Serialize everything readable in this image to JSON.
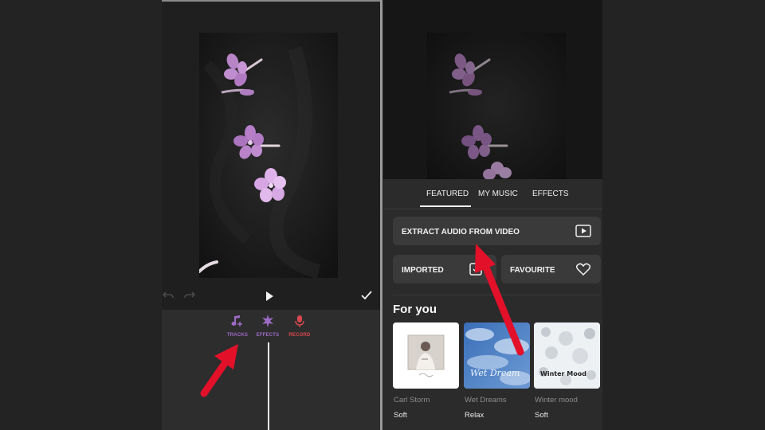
{
  "left": {
    "tools": [
      {
        "label": "TRACKS",
        "color": "#9d6bc6",
        "icon": "music-note-plus-icon"
      },
      {
        "label": "EFFECTS",
        "color": "#9d6bc6",
        "icon": "sparkle-icon"
      },
      {
        "label": "RECORD",
        "color": "#d9484e",
        "icon": "microphone-icon"
      }
    ],
    "controls": {
      "undo": "undo-icon",
      "redo": "redo-icon",
      "play": "play-icon",
      "confirm": "check-icon"
    }
  },
  "right": {
    "tabs": [
      {
        "label": "FEATURED",
        "active": true
      },
      {
        "label": "MY MUSIC",
        "active": false
      },
      {
        "label": "EFFECTS",
        "active": false
      }
    ],
    "extract_label": "EXTRACT AUDIO FROM VIDEO",
    "imported_label": "IMPORTED",
    "favourite_label": "FAVOURITE",
    "section_title": "For you",
    "albums": [
      {
        "title": "Carl Storm",
        "genre": "Soft",
        "cover_text": ""
      },
      {
        "title": "Wet Dreams",
        "genre": "Relax",
        "cover_text": "Wet Dream"
      },
      {
        "title": "Winter mood",
        "genre": "Soft",
        "cover_text": "Winter Mood"
      }
    ]
  },
  "colors": {
    "background": "#232323",
    "arrow": "#e3102a",
    "accent_purple": "#9d6bc6",
    "accent_red": "#d9484e"
  }
}
